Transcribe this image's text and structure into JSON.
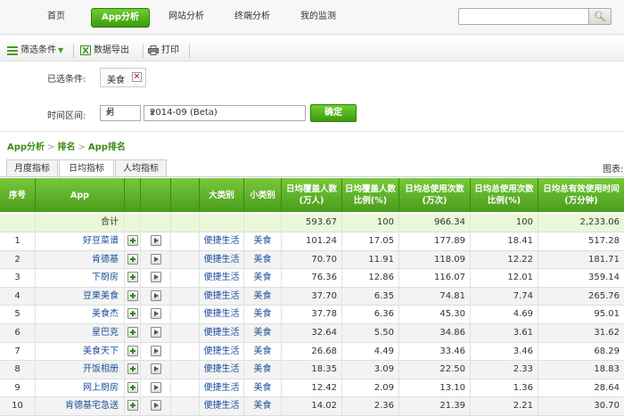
{
  "nav": {
    "items": [
      {
        "label": "首页",
        "active": false
      },
      {
        "label": "App分析",
        "active": true
      },
      {
        "label": "网站分析",
        "active": false
      },
      {
        "label": "终端分析",
        "active": false
      },
      {
        "label": "我的监测",
        "active": false
      }
    ],
    "search_value": ""
  },
  "toolbar": {
    "filter_label": "筛选条件",
    "export_label": "数据导出",
    "print_label": "打印"
  },
  "filters": {
    "selected_label": "已选条件:",
    "selected_tag": "美食",
    "time_label": "时间区间:",
    "period_value": "月",
    "month_value": "2014-09 (Beta)",
    "confirm_label": "确定"
  },
  "breadcrumb": {
    "items": [
      "App分析",
      "排名",
      "App排名"
    ]
  },
  "tabs": [
    {
      "label": "月度指标",
      "active": false
    },
    {
      "label": "日均指标",
      "active": true
    },
    {
      "label": "人均指标",
      "active": false
    }
  ],
  "chart_label": "图表:",
  "table": {
    "headers": [
      "序号",
      "App",
      "大类别",
      "小类别",
      "日均覆盖人数\n(万人)",
      "日均覆盖人数\n比例(%)",
      "日均总使用次数\n(万次)",
      "日均总使用次数\n比例(%)",
      "日均总有效使用时间\n(万分钟)"
    ],
    "total": {
      "label": "合计",
      "v1": "593.67",
      "v2": "100",
      "v3": "966.34",
      "v4": "100",
      "v5": "2,233.06"
    },
    "rows": [
      {
        "rank": "1",
        "app": "好豆菜谱",
        "cat": "便捷生活",
        "sub": "美食",
        "v1": "101.24",
        "v2": "17.05",
        "v3": "177.89",
        "v4": "18.41",
        "v5": "517.28"
      },
      {
        "rank": "2",
        "app": "肯德基",
        "cat": "便捷生活",
        "sub": "美食",
        "v1": "70.70",
        "v2": "11.91",
        "v3": "118.09",
        "v4": "12.22",
        "v5": "181.71"
      },
      {
        "rank": "3",
        "app": "下厨房",
        "cat": "便捷生活",
        "sub": "美食",
        "v1": "76.36",
        "v2": "12.86",
        "v3": "116.07",
        "v4": "12.01",
        "v5": "359.14"
      },
      {
        "rank": "4",
        "app": "豆果美食",
        "cat": "便捷生活",
        "sub": "美食",
        "v1": "37.70",
        "v2": "6.35",
        "v3": "74.81",
        "v4": "7.74",
        "v5": "265.76"
      },
      {
        "rank": "5",
        "app": "美食杰",
        "cat": "便捷生活",
        "sub": "美食",
        "v1": "37.78",
        "v2": "6.36",
        "v3": "45.30",
        "v4": "4.69",
        "v5": "95.01"
      },
      {
        "rank": "6",
        "app": "星巴克",
        "cat": "便捷生活",
        "sub": "美食",
        "v1": "32.64",
        "v2": "5.50",
        "v3": "34.86",
        "v4": "3.61",
        "v5": "31.62"
      },
      {
        "rank": "7",
        "app": "美食天下",
        "cat": "便捷生活",
        "sub": "美食",
        "v1": "26.68",
        "v2": "4.49",
        "v3": "33.46",
        "v4": "3.46",
        "v5": "68.29"
      },
      {
        "rank": "8",
        "app": "开饭相册",
        "cat": "便捷生活",
        "sub": "美食",
        "v1": "18.35",
        "v2": "3.09",
        "v3": "22.50",
        "v4": "2.33",
        "v5": "18.83"
      },
      {
        "rank": "9",
        "app": "网上厨房",
        "cat": "便捷生活",
        "sub": "美食",
        "v1": "12.42",
        "v2": "2.09",
        "v3": "13.10",
        "v4": "1.36",
        "v5": "28.64"
      },
      {
        "rank": "10",
        "app": "肯德基宅急送",
        "cat": "便捷生活",
        "sub": "美食",
        "v1": "14.02",
        "v2": "2.36",
        "v3": "21.39",
        "v4": "2.21",
        "v5": "30.70"
      }
    ]
  }
}
